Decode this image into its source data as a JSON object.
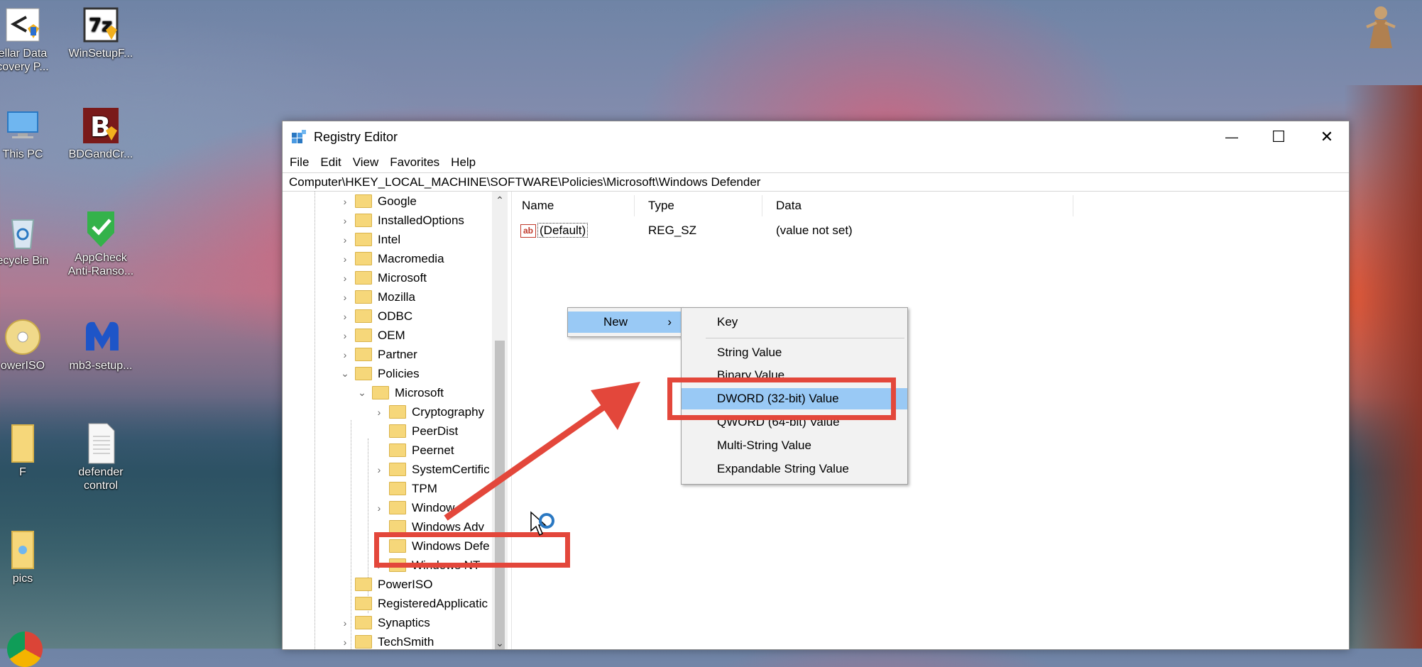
{
  "desktop": {
    "icons": [
      {
        "label": "ellar Data\ncovery P..."
      },
      {
        "label": "WinSetupF..."
      },
      {
        "label": "This PC"
      },
      {
        "label": "BDGandCr..."
      },
      {
        "label": "ecycle Bin"
      },
      {
        "label": "AppCheck\nAnti-Ranso..."
      },
      {
        "label": "owerISO"
      },
      {
        "label": "mb3-setup..."
      },
      {
        "label": "F"
      },
      {
        "label": "defender\ncontrol"
      },
      {
        "label": "pics"
      }
    ]
  },
  "window": {
    "title": "Registry Editor",
    "controls": {
      "minimize": "—",
      "maximize": "☐",
      "close": "✕"
    },
    "menu": [
      "File",
      "Edit",
      "View",
      "Favorites",
      "Help"
    ],
    "address": "Computer\\HKEY_LOCAL_MACHINE\\SOFTWARE\\Policies\\Microsoft\\Windows Defender"
  },
  "tree": {
    "items": [
      {
        "label": "Google"
      },
      {
        "label": "InstalledOptions"
      },
      {
        "label": "Intel"
      },
      {
        "label": "Macromedia"
      },
      {
        "label": "Microsoft"
      },
      {
        "label": "Mozilla"
      },
      {
        "label": "ODBC"
      },
      {
        "label": "OEM"
      },
      {
        "label": "Partner"
      },
      {
        "label": "Policies"
      },
      {
        "label": "Microsoft"
      },
      {
        "label": "Cryptography"
      },
      {
        "label": "PeerDist"
      },
      {
        "label": "Peernet"
      },
      {
        "label": "SystemCertific"
      },
      {
        "label": "TPM"
      },
      {
        "label": "Window"
      },
      {
        "label": "Windows Adv"
      },
      {
        "label": "Windows Defe"
      },
      {
        "label": "Windows NT"
      },
      {
        "label": "PowerISO"
      },
      {
        "label": "RegisteredApplicatic"
      },
      {
        "label": "Synaptics"
      },
      {
        "label": "TechSmith"
      }
    ]
  },
  "list": {
    "columns": [
      "Name",
      "Type",
      "Data"
    ],
    "rows": [
      {
        "icon": "ab",
        "name": "(Default)",
        "type": "REG_SZ",
        "data": "(value not set)"
      }
    ]
  },
  "context_menu": {
    "parent": "New",
    "submenu": [
      "Key",
      "String Value",
      "Binary Value",
      "DWORD (32-bit) Value",
      "QWORD (64-bit) Value",
      "Multi-String Value",
      "Expandable String Value"
    ],
    "highlighted": "DWORD (32-bit) Value"
  },
  "annotation": {
    "color": "#e3473b"
  }
}
